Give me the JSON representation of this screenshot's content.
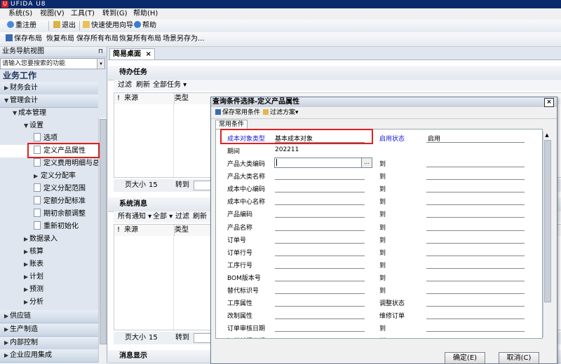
{
  "app": {
    "title": "UFIDA U8"
  },
  "menu": [
    "系统(S)",
    "视图(V)",
    "工具(T)",
    "转到(G)",
    "帮助(H)"
  ],
  "toolbar1": {
    "reregister": "重注册",
    "exit": "退出",
    "quick_guide": "快速使用向导",
    "help": "帮助"
  },
  "toolbar2": {
    "save_layout": "保存布局",
    "restore_layout": "恢复布局",
    "save_all": "保存所有布局",
    "restore_all": "恢复所有布局",
    "save_scene": "场景另存为..."
  },
  "nav": {
    "header": "业务导航视图",
    "search_placeholder": "请输入您要搜索的功能",
    "title": "业务工作",
    "items": [
      {
        "label": "财务会计"
      },
      {
        "label": "管理会计"
      },
      {
        "label": "成本管理"
      },
      {
        "label": "设置"
      },
      {
        "label": "选项"
      },
      {
        "label": "定义产品属性"
      },
      {
        "label": "定义费用明细与总账"
      },
      {
        "label": "定义分配率"
      },
      {
        "label": "定义分配范围"
      },
      {
        "label": "定额分配标准"
      },
      {
        "label": "期初余额调整"
      },
      {
        "label": "重新初始化"
      },
      {
        "label": "数据录入"
      },
      {
        "label": "核算"
      },
      {
        "label": "账表"
      },
      {
        "label": "计划"
      },
      {
        "label": "预测"
      },
      {
        "label": "分析"
      },
      {
        "label": "供应链"
      },
      {
        "label": "生产制造"
      },
      {
        "label": "内部控制"
      },
      {
        "label": "企业应用集成"
      }
    ]
  },
  "main": {
    "tab_label": "简易桌面",
    "tab_close": "×",
    "todo": {
      "title": "待办任务",
      "toolbar": [
        "过滤",
        "刷新",
        "全部任务 ▾"
      ],
      "columns": [
        "!",
        "来源",
        "类型"
      ],
      "page_size_label": "页大小",
      "page_size": "15",
      "goto": "转到"
    },
    "sysmsg": {
      "title": "系统消息",
      "toolbar": [
        "所有通知 ▾",
        "全部 ▾",
        "过滤",
        "刷新"
      ],
      "columns": [
        "!",
        "来源",
        "类型"
      ],
      "page_size_label": "页大小",
      "page_size": "15",
      "goto": "转到"
    },
    "msg_display": "消息显示"
  },
  "dialog": {
    "title": "查询条件选择-定义产品属性",
    "close": "×",
    "toolbar": {
      "save_common": "保存常用条件",
      "filter_scheme": "过滤方案▾"
    },
    "tab": "常用条件",
    "cost_object_type_label": "成本对象类型",
    "cost_object_type_value": "基本成本对象",
    "enabled_status_label": "启用状态",
    "enabled_status_value": "启用",
    "period_label": "期间",
    "period_value": "202211",
    "to_label": "到",
    "browse_button": "...",
    "fields": [
      "产品大类编码",
      "产品大类名称",
      "成本中心编码",
      "成本中心名称",
      "产品编码",
      "产品名称",
      "订单号",
      "订单行号",
      "工序行号",
      "BOM版本号",
      "替代标识号",
      "工序属性",
      "改制属性",
      "订单审核日期",
      "订单关闭日期"
    ],
    "right_labels": {
      "替代标识号": "到",
      "工序属性": "调整状态",
      "改制属性": "维修订单",
      "订单审核日期": "到",
      "订单关闭日期": "到"
    },
    "ok": "确定(E)",
    "cancel": "取消(C)"
  },
  "colors": {
    "title_bar": "#0a2a6b",
    "highlight": "#e02020",
    "blue_label": "#1a1adb"
  }
}
